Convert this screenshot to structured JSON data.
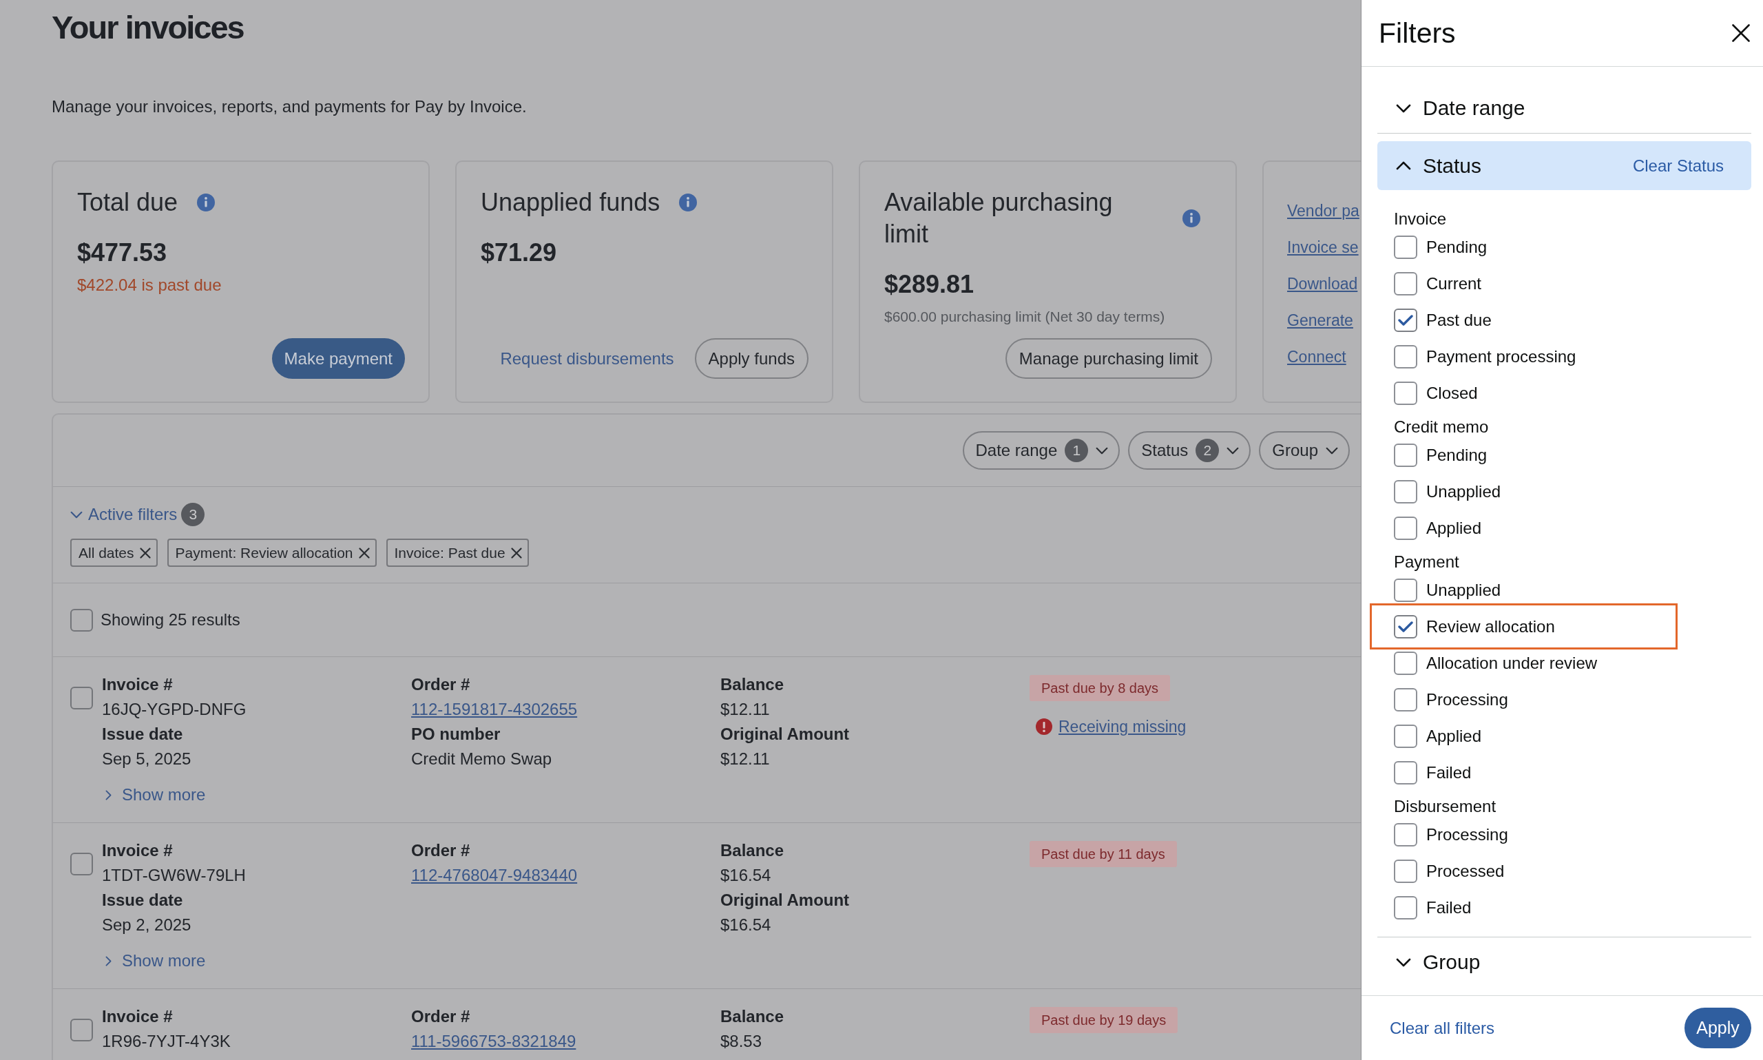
{
  "page": {
    "title": "Your invoices",
    "subtitle": "Manage your invoices, reports, and payments for Pay by Invoice."
  },
  "cards": [
    {
      "kind": "summary",
      "title": "Total due",
      "amount": "$477.53",
      "note": {
        "text": "$422.04 is past due",
        "kind": "alert"
      },
      "actions": [
        {
          "label": "Make payment",
          "kind": "primary"
        }
      ]
    },
    {
      "kind": "summary",
      "title": "Unapplied funds",
      "amount": "$71.29",
      "actions": [
        {
          "label": "Request disbursements",
          "kind": "link"
        },
        {
          "label": "Apply funds",
          "kind": "secondary"
        }
      ]
    },
    {
      "kind": "summary",
      "title": "Available purchasing limit",
      "amount": "$289.81",
      "note": {
        "text": "$600.00 purchasing limit (Net 30 day terms)",
        "kind": "muted"
      },
      "actions": [
        {
          "label": "Manage purchasing limit",
          "kind": "secondary"
        }
      ]
    },
    {
      "kind": "links",
      "links": [
        "Vendor pa",
        "Invoice se",
        "Download",
        "Generate",
        "Connect"
      ]
    }
  ],
  "filter_bar": {
    "buttons": [
      {
        "label": "Date range",
        "count": "1"
      },
      {
        "label": "Status",
        "count": "2"
      },
      {
        "label": "Group"
      }
    ]
  },
  "active_filters": {
    "label": "Active filters",
    "count": "3",
    "expanded": true,
    "chips": [
      "All dates",
      "Payment: Review allocation",
      "Invoice: Past due"
    ]
  },
  "results": {
    "label": "Showing 25 results",
    "checked": false
  },
  "invoices": [
    {
      "checked": false,
      "columns": [
        [
          {
            "label": "Invoice #",
            "value": "16JQ-YGPD-DNFG",
            "kind": "text"
          },
          {
            "label": "Issue date",
            "value": "Sep 5, 2025",
            "kind": "text"
          }
        ],
        [
          {
            "label": "Order #",
            "value": "112-1591817-4302655",
            "kind": "link"
          },
          {
            "label": "PO number",
            "value": "Credit Memo Swap",
            "kind": "text"
          }
        ],
        [
          {
            "label": "Balance",
            "value": "$12.11",
            "kind": "text"
          },
          {
            "label": "Original Amount",
            "value": "$12.11",
            "kind": "text"
          }
        ]
      ],
      "status": "Past due by 8 days",
      "alert": "Receiving missing",
      "show_more": {
        "label": "Show more",
        "expanded": false
      }
    },
    {
      "checked": false,
      "columns": [
        [
          {
            "label": "Invoice #",
            "value": "1TDT-GW6W-79LH",
            "kind": "text"
          },
          {
            "label": "Issue date",
            "value": "Sep 2, 2025",
            "kind": "text"
          }
        ],
        [
          {
            "label": "Order #",
            "value": "112-4768047-9483440",
            "kind": "link"
          }
        ],
        [
          {
            "label": "Balance",
            "value": "$16.54",
            "kind": "text"
          },
          {
            "label": "Original Amount",
            "value": "$16.54",
            "kind": "text"
          }
        ]
      ],
      "status": "Past due by 11 days",
      "show_more": {
        "label": "Show more",
        "expanded": false
      }
    },
    {
      "checked": false,
      "columns": [
        [
          {
            "label": "Invoice #",
            "value": "1R96-7YJT-4Y3K",
            "kind": "text"
          }
        ],
        [
          {
            "label": "Order #",
            "value": "111-5966753-8321849",
            "kind": "link"
          }
        ],
        [
          {
            "label": "Balance",
            "value": "$8.53",
            "kind": "text"
          }
        ]
      ],
      "status": "Past due by 19 days"
    }
  ],
  "filters_panel": {
    "title": "Filters",
    "sections": [
      {
        "title": "Date range",
        "expanded": false
      },
      {
        "title": "Status",
        "expanded": true,
        "action": "Clear Status",
        "groups": [
          {
            "label": "Invoice",
            "options": [
              {
                "label": "Pending",
                "checked": false,
                "highlighted": false
              },
              {
                "label": "Current",
                "checked": false,
                "highlighted": false
              },
              {
                "label": "Past due",
                "checked": true,
                "highlighted": false
              },
              {
                "label": "Payment processing",
                "checked": false,
                "highlighted": false
              },
              {
                "label": "Closed",
                "checked": false,
                "highlighted": false
              }
            ]
          },
          {
            "label": "Credit memo",
            "options": [
              {
                "label": "Pending",
                "checked": false,
                "highlighted": false
              },
              {
                "label": "Unapplied",
                "checked": false,
                "highlighted": false
              },
              {
                "label": "Applied",
                "checked": false,
                "highlighted": false
              }
            ]
          },
          {
            "label": "Payment",
            "options": [
              {
                "label": "Unapplied",
                "checked": false,
                "highlighted": false
              },
              {
                "label": "Review allocation",
                "checked": true,
                "highlighted": true
              },
              {
                "label": "Allocation under review",
                "checked": false,
                "highlighted": false
              },
              {
                "label": "Processing",
                "checked": false,
                "highlighted": false
              },
              {
                "label": "Applied",
                "checked": false,
                "highlighted": false
              },
              {
                "label": "Failed",
                "checked": false,
                "highlighted": false
              }
            ]
          },
          {
            "label": "Disbursement",
            "options": [
              {
                "label": "Processing",
                "checked": false,
                "highlighted": false
              },
              {
                "label": "Processed",
                "checked": false,
                "highlighted": false
              },
              {
                "label": "Failed",
                "checked": false,
                "highlighted": false
              }
            ]
          }
        ]
      },
      {
        "title": "Group",
        "expanded": false
      }
    ],
    "footer": {
      "clear": "Clear all filters",
      "apply": "Apply"
    }
  }
}
